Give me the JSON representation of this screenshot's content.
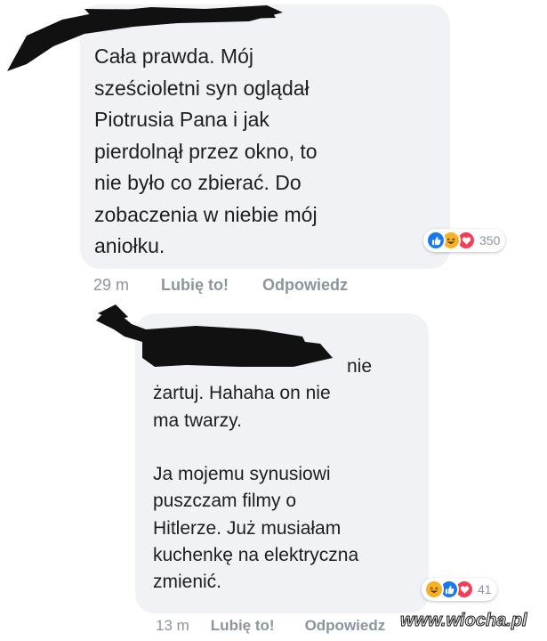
{
  "colors": {
    "bubble": "#f0f2f5",
    "like_blue": "#1877f2",
    "heart_red": "#f33e58",
    "haha_yellow": "#f7b125",
    "meta_gray": "#8d949e"
  },
  "comments": [
    {
      "author": "",
      "text": "Cała prawda. Mój\nsześcioletni syn oglądał\nPiotrusia Pana i jak\npierdolnął przez okno, to\nnie było co zbierać. Do\nzobaczenia w niebie mój\naniołku.",
      "reactions": [
        "like-icon",
        "haha-icon",
        "love-icon"
      ],
      "reaction_count": "350",
      "time": "29 m",
      "like_label": "Lubię to!",
      "reply_label": "Odpowiedz"
    },
    {
      "author": "",
      "text": "nie\nżartuj.  Hahaha on nie\nma twarzy.\n\nJa mojemu synusiowi\npuszczam filmy o\nHitlerze.  Już musiałam\nkuchenkę na elektryczna\nzmienić.",
      "reactions": [
        "haha-icon",
        "like-icon",
        "love-icon"
      ],
      "reaction_count": "41",
      "time": "13 m",
      "like_label": "Lubię to!",
      "reply_label": "Odpowiedz"
    }
  ],
  "watermark": "www.wiocha.pl"
}
